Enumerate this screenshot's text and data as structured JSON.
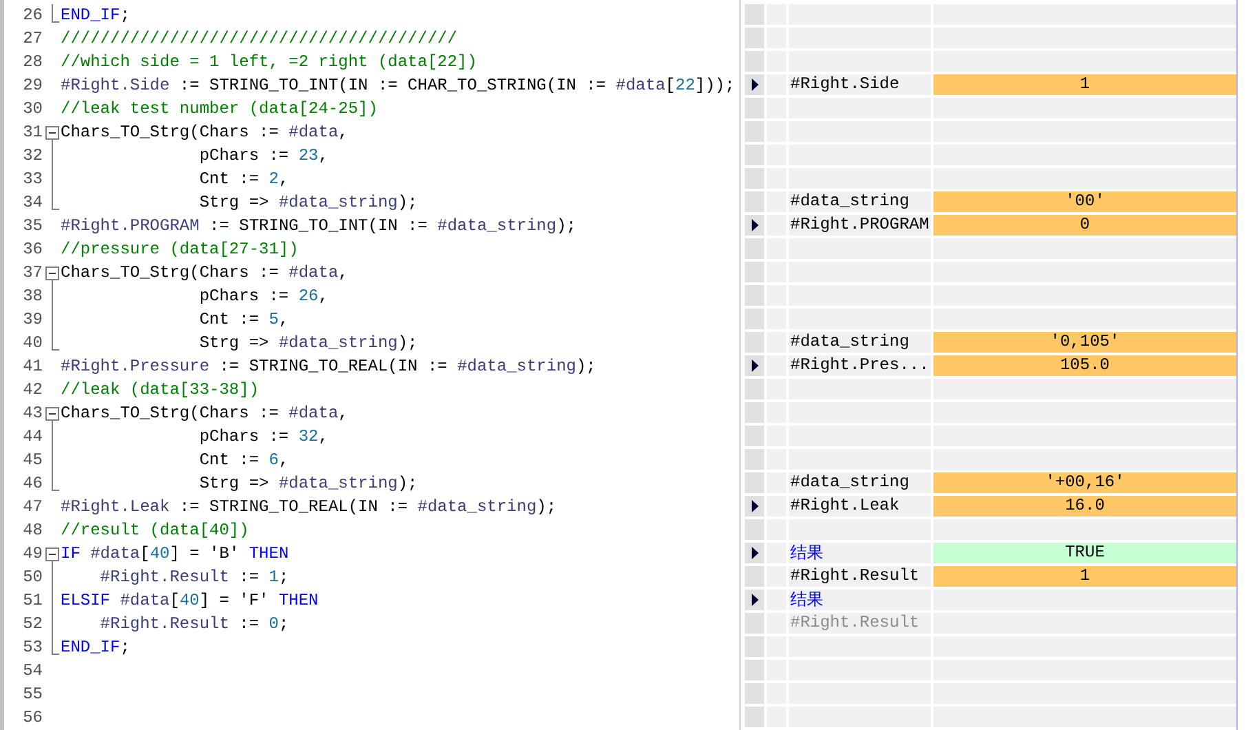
{
  "code_lines": [
    {
      "number": "26",
      "kind": "block_end",
      "segments": [
        {
          "kind": "kw",
          "text": "END_IF"
        },
        {
          "kind": "plain",
          "text": ";"
        }
      ]
    },
    {
      "number": "27",
      "kind": "plain",
      "segments": [
        {
          "kind": "comment",
          "text": "////////////////////////////////////////"
        }
      ]
    },
    {
      "number": "28",
      "kind": "plain",
      "segments": [
        {
          "kind": "comment",
          "text": "//which side = 1 left, =2 right (data[22])"
        }
      ]
    },
    {
      "number": "29",
      "kind": "plain",
      "segments": [
        {
          "kind": "var",
          "text": "#Right.Side"
        },
        {
          "kind": "plain",
          "text": " := STRING_TO_INT(IN := CHAR_TO_STRING(IN := "
        },
        {
          "kind": "var",
          "text": "#data"
        },
        {
          "kind": "plain",
          "text": "["
        },
        {
          "kind": "num",
          "text": "22"
        },
        {
          "kind": "plain",
          "text": "]));"
        }
      ]
    },
    {
      "number": "30",
      "kind": "plain",
      "segments": [
        {
          "kind": "comment",
          "text": "//leak test number (data[24-25])"
        }
      ]
    },
    {
      "number": "31",
      "kind": "block_start",
      "segments": [
        {
          "kind": "plain",
          "text": "Chars_TO_Strg(Chars := "
        },
        {
          "kind": "var",
          "text": "#data"
        },
        {
          "kind": "plain",
          "text": ","
        }
      ]
    },
    {
      "number": "32",
      "kind": "block_body",
      "segments": [
        {
          "kind": "plain",
          "text": "              pChars := "
        },
        {
          "kind": "num",
          "text": "23"
        },
        {
          "kind": "plain",
          "text": ","
        }
      ]
    },
    {
      "number": "33",
      "kind": "block_body",
      "segments": [
        {
          "kind": "plain",
          "text": "              Cnt := "
        },
        {
          "kind": "num",
          "text": "2"
        },
        {
          "kind": "plain",
          "text": ","
        }
      ]
    },
    {
      "number": "34",
      "kind": "block_end",
      "segments": [
        {
          "kind": "plain",
          "text": "              Strg => "
        },
        {
          "kind": "var",
          "text": "#data_string"
        },
        {
          "kind": "plain",
          "text": ");"
        }
      ]
    },
    {
      "number": "35",
      "kind": "plain",
      "segments": [
        {
          "kind": "var",
          "text": "#Right.PROGRAM"
        },
        {
          "kind": "plain",
          "text": " := STRING_TO_INT(IN := "
        },
        {
          "kind": "var",
          "text": "#data_string"
        },
        {
          "kind": "plain",
          "text": ");"
        }
      ]
    },
    {
      "number": "36",
      "kind": "plain",
      "segments": [
        {
          "kind": "comment",
          "text": "//pressure (data[27-31])"
        }
      ]
    },
    {
      "number": "37",
      "kind": "block_start",
      "segments": [
        {
          "kind": "plain",
          "text": "Chars_TO_Strg(Chars := "
        },
        {
          "kind": "var",
          "text": "#data"
        },
        {
          "kind": "plain",
          "text": ","
        }
      ]
    },
    {
      "number": "38",
      "kind": "block_body",
      "segments": [
        {
          "kind": "plain",
          "text": "              pChars := "
        },
        {
          "kind": "num",
          "text": "26"
        },
        {
          "kind": "plain",
          "text": ","
        }
      ]
    },
    {
      "number": "39",
      "kind": "block_body",
      "segments": [
        {
          "kind": "plain",
          "text": "              Cnt := "
        },
        {
          "kind": "num",
          "text": "5"
        },
        {
          "kind": "plain",
          "text": ","
        }
      ]
    },
    {
      "number": "40",
      "kind": "block_end",
      "segments": [
        {
          "kind": "plain",
          "text": "              Strg => "
        },
        {
          "kind": "var",
          "text": "#data_string"
        },
        {
          "kind": "plain",
          "text": ");"
        }
      ]
    },
    {
      "number": "41",
      "kind": "plain",
      "segments": [
        {
          "kind": "var",
          "text": "#Right.Pressure"
        },
        {
          "kind": "plain",
          "text": " := STRING_TO_REAL(IN := "
        },
        {
          "kind": "var",
          "text": "#data_string"
        },
        {
          "kind": "plain",
          "text": ");"
        }
      ]
    },
    {
      "number": "42",
      "kind": "plain",
      "segments": [
        {
          "kind": "comment",
          "text": "//leak (data[33-38])"
        }
      ]
    },
    {
      "number": "43",
      "kind": "block_start",
      "segments": [
        {
          "kind": "plain",
          "text": "Chars_TO_Strg(Chars := "
        },
        {
          "kind": "var",
          "text": "#data"
        },
        {
          "kind": "plain",
          "text": ","
        }
      ]
    },
    {
      "number": "44",
      "kind": "block_body",
      "segments": [
        {
          "kind": "plain",
          "text": "              pChars := "
        },
        {
          "kind": "num",
          "text": "32"
        },
        {
          "kind": "plain",
          "text": ","
        }
      ]
    },
    {
      "number": "45",
      "kind": "block_body",
      "segments": [
        {
          "kind": "plain",
          "text": "              Cnt := "
        },
        {
          "kind": "num",
          "text": "6"
        },
        {
          "kind": "plain",
          "text": ","
        }
      ]
    },
    {
      "number": "46",
      "kind": "block_end",
      "segments": [
        {
          "kind": "plain",
          "text": "              Strg => "
        },
        {
          "kind": "var",
          "text": "#data_string"
        },
        {
          "kind": "plain",
          "text": ");"
        }
      ]
    },
    {
      "number": "47",
      "kind": "plain",
      "segments": [
        {
          "kind": "var",
          "text": "#Right.Leak"
        },
        {
          "kind": "plain",
          "text": " := STRING_TO_REAL(IN := "
        },
        {
          "kind": "var",
          "text": "#data_string"
        },
        {
          "kind": "plain",
          "text": ");"
        }
      ]
    },
    {
      "number": "48",
      "kind": "plain",
      "segments": [
        {
          "kind": "comment",
          "text": "//result (data[40])"
        }
      ]
    },
    {
      "number": "49",
      "kind": "block_start",
      "segments": [
        {
          "kind": "kw",
          "text": "IF "
        },
        {
          "kind": "var",
          "text": "#data"
        },
        {
          "kind": "plain",
          "text": "["
        },
        {
          "kind": "num",
          "text": "40"
        },
        {
          "kind": "plain",
          "text": "] = 'B' "
        },
        {
          "kind": "kw",
          "text": "THEN"
        }
      ]
    },
    {
      "number": "50",
      "kind": "block_body",
      "segments": [
        {
          "kind": "var",
          "text": "    #Right.Result"
        },
        {
          "kind": "plain",
          "text": " := "
        },
        {
          "kind": "num",
          "text": "1"
        },
        {
          "kind": "plain",
          "text": ";"
        }
      ]
    },
    {
      "number": "51",
      "kind": "block_body",
      "segments": [
        {
          "kind": "kw",
          "text": "ELSIF "
        },
        {
          "kind": "var",
          "text": "#data"
        },
        {
          "kind": "plain",
          "text": "["
        },
        {
          "kind": "num",
          "text": "40"
        },
        {
          "kind": "plain",
          "text": "] = 'F' "
        },
        {
          "kind": "kw",
          "text": "THEN"
        }
      ]
    },
    {
      "number": "52",
      "kind": "block_body",
      "segments": [
        {
          "kind": "var",
          "text": "    #Right.Result"
        },
        {
          "kind": "plain",
          "text": " := "
        },
        {
          "kind": "num",
          "text": "0"
        },
        {
          "kind": "plain",
          "text": ";"
        }
      ]
    },
    {
      "number": "53",
      "kind": "block_end",
      "segments": [
        {
          "kind": "kw",
          "text": "END_IF"
        },
        {
          "kind": "plain",
          "text": ";"
        }
      ]
    },
    {
      "number": "54",
      "kind": "plain"
    },
    {
      "number": "55",
      "kind": "plain"
    },
    {
      "number": "56",
      "kind": "plain"
    }
  ],
  "watch_rows": [
    {
      "marker": false
    },
    {
      "marker": false
    },
    {
      "marker": false
    },
    {
      "marker": true,
      "name": "#Right.Side",
      "kind": "normal",
      "value": "1",
      "color": "#ffc864"
    },
    {
      "marker": false
    },
    {
      "marker": false
    },
    {
      "marker": false
    },
    {
      "marker": false
    },
    {
      "marker": false,
      "name": "#data_string",
      "kind": "normal",
      "value": "'00'",
      "color": "#ffc864"
    },
    {
      "marker": true,
      "name": "#Right.PROGRAM",
      "kind": "normal",
      "value": "0",
      "color": "#ffc864"
    },
    {
      "marker": false
    },
    {
      "marker": false
    },
    {
      "marker": false
    },
    {
      "marker": false
    },
    {
      "marker": false,
      "name": "#data_string",
      "kind": "normal",
      "value": "'0,105'",
      "color": "#ffc864"
    },
    {
      "marker": true,
      "name": "#Right.Pres...",
      "kind": "normal",
      "value": "105.0",
      "color": "#ffc864"
    },
    {
      "marker": false
    },
    {
      "marker": false
    },
    {
      "marker": false
    },
    {
      "marker": false
    },
    {
      "marker": false,
      "name": "#data_string",
      "kind": "normal",
      "value": "'+00,16'",
      "color": "#ffc864"
    },
    {
      "marker": true,
      "name": "#Right.Leak",
      "kind": "normal",
      "value": "16.0",
      "color": "#ffc864"
    },
    {
      "marker": false
    },
    {
      "marker": true,
      "name": "结果",
      "kind": "label",
      "value": "TRUE",
      "color": "#c6ffd4"
    },
    {
      "marker": false,
      "name": "#Right.Result",
      "kind": "normal",
      "value": "1",
      "color": "#ffc864"
    },
    {
      "marker": true,
      "name": "结果",
      "kind": "label"
    },
    {
      "marker": false,
      "name": "#Right.Result",
      "kind": "dimmed"
    },
    {
      "marker": false
    },
    {
      "marker": false
    },
    {
      "marker": false
    },
    {
      "marker": false
    }
  ]
}
